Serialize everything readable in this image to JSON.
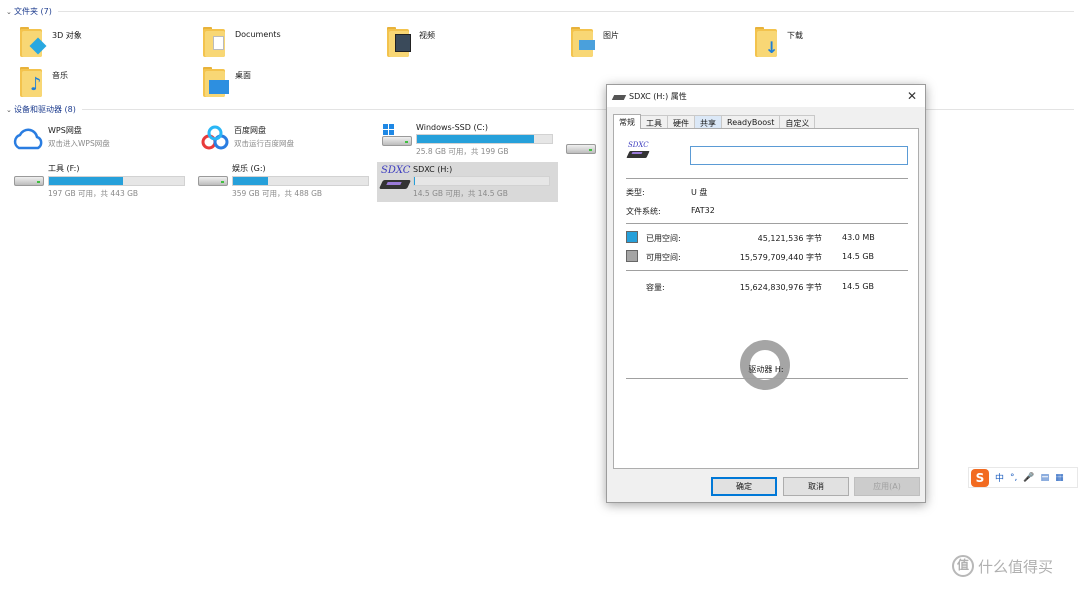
{
  "folders_group": {
    "title": "文件夹 (7)"
  },
  "folders": [
    {
      "name": "3D 对象",
      "icon": "3d-objects-folder-icon"
    },
    {
      "name": "Documents",
      "icon": "documents-folder-icon"
    },
    {
      "name": "视频",
      "icon": "videos-folder-icon"
    },
    {
      "name": "图片",
      "icon": "pictures-folder-icon"
    },
    {
      "name": "下载",
      "icon": "downloads-folder-icon"
    },
    {
      "name": "音乐",
      "icon": "music-folder-icon"
    },
    {
      "name": "桌面",
      "icon": "desktop-folder-icon"
    }
  ],
  "devices_group": {
    "title": "设备和驱动器 (8)"
  },
  "devices": [
    {
      "name": "WPS网盘",
      "sub": "双击进入WPS网盘",
      "icon": "wps-cloud-icon"
    },
    {
      "name": "百度网盘",
      "sub": "双击运行百度网盘",
      "icon": "baidu-netdisk-icon"
    },
    {
      "name": "Windows-SSD (C:)",
      "sub": "25.8 GB 可用，共 199 GB",
      "used_fraction": 0.87,
      "icon": "windows-drive-icon"
    },
    {
      "name": "工具 (F:)",
      "sub": "197 GB 可用，共 443 GB",
      "used_fraction": 0.55,
      "icon": "hard-drive-icon"
    },
    {
      "name": "娱乐 (G:)",
      "sub": "359 GB 可用，共 488 GB",
      "used_fraction": 0.26,
      "icon": "hard-drive-icon"
    },
    {
      "name": "SDXC (H:)",
      "sub": "14.5 GB 可用，共 14.5 GB",
      "used_fraction": 0.003,
      "icon": "sdxc-card-icon",
      "card_label": "SDXC"
    }
  ],
  "dialog": {
    "title": "SDXC (H:) 属性",
    "tabs": [
      "常规",
      "工具",
      "硬件",
      "共享",
      "ReadyBoost",
      "自定义"
    ],
    "name_value": "",
    "card_label": "SDXC",
    "type_label": "类型:",
    "type_value": "U 盘",
    "fs_label": "文件系统:",
    "fs_value": "FAT32",
    "used_label": "已用空间:",
    "used_bytes": "45,121,536 字节",
    "used_size": "43.0 MB",
    "free_label": "可用空间:",
    "free_bytes": "15,579,709,440 字节",
    "free_size": "14.5 GB",
    "capacity_label": "容量:",
    "capacity_bytes": "15,624,830,976 字节",
    "capacity_size": "14.5 GB",
    "drive_label": "驱动器 H:",
    "ok_label": "确定",
    "cancel_label": "取消",
    "apply_label": "应用(A)",
    "used_color": "#26a0da",
    "free_color": "#a5a5a5"
  },
  "ime": {
    "items": [
      "中",
      "°,",
      "mic-icon",
      "keyboard-icon",
      "grid-icon"
    ]
  },
  "watermark": {
    "glyph": "值",
    "text": "什么值得买"
  }
}
